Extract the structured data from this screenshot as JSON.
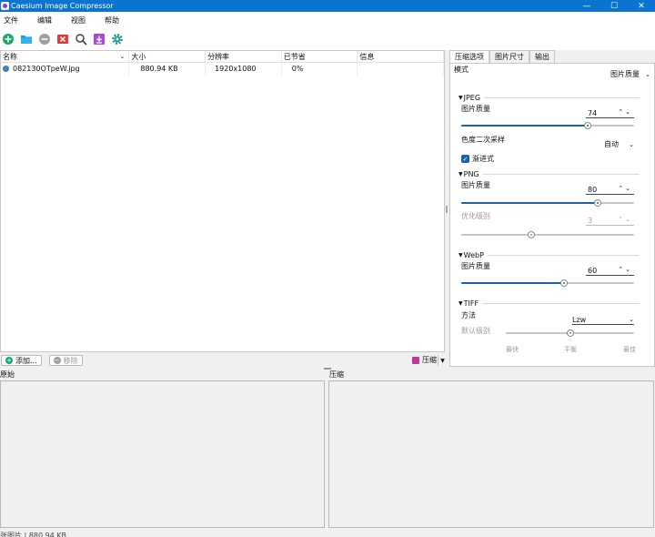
{
  "window": {
    "title": "Caesium Image Compressor",
    "min": "—",
    "max": "☐",
    "close": "✕"
  },
  "menu": [
    "文件",
    "编辑",
    "视图",
    "帮助"
  ],
  "list": {
    "headers": [
      "名称",
      "大小",
      "分辨率",
      "已节省",
      "信息"
    ],
    "rows": [
      {
        "name": "082130OTpeW.jpg",
        "size": "880.94 KB",
        "resolution": "1920x1080",
        "saved": "0%",
        "info": ""
      }
    ]
  },
  "buttons": {
    "add": "添加...",
    "remove": "移除",
    "compress": "压缩"
  },
  "tabs": [
    "压缩选项",
    "图片尺寸",
    "输出"
  ],
  "options": {
    "mode_label": "模式",
    "mode_value": "图片质量",
    "jpeg": {
      "title": "JPEG",
      "quality_label": "图片质量",
      "quality": "74",
      "quality_frac": 0.74,
      "subsampling_label": "色度二次采样",
      "subsampling_value": "自动",
      "progressive_label": "渐进式"
    },
    "png": {
      "title": "PNG",
      "quality_label": "图片质量",
      "quality": "80",
      "quality_frac": 0.8,
      "opt_label": "优化级别",
      "opt_value": "3",
      "opt_frac": 0.4
    },
    "webp": {
      "title": "WebP",
      "quality_label": "图片质量",
      "quality": "60",
      "quality_frac": 0.6
    },
    "tiff": {
      "title": "TIFF",
      "method_label": "方法",
      "method_value": "Lzw",
      "level_label": "默认级别",
      "level_frac": 0.5,
      "ticks": [
        "最快",
        "平衡",
        "最佳"
      ]
    }
  },
  "preview": {
    "original": "原始",
    "compressed": "压缩"
  },
  "status": "张图片 | 880.94 KB"
}
